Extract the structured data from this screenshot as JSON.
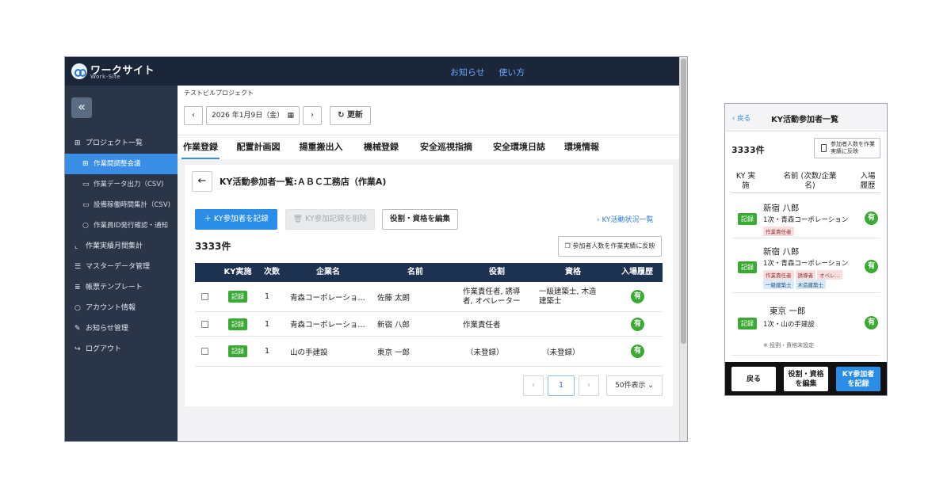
{
  "app": {
    "logo_name": "ワークサイト",
    "logo_sub": "Work-Site"
  },
  "topbar": {
    "links": [
      "お知らせ",
      "使い方"
    ]
  },
  "sidebar": {
    "items": [
      {
        "icon": "building-icon",
        "label": "プロジェクト一覧"
      },
      {
        "icon": "building-icon",
        "label": "作業間調整会議",
        "active": true
      },
      {
        "icon": "book-icon",
        "label": "作業データ出力（CSV)"
      },
      {
        "icon": "book-icon",
        "label": "設備稼働時間集計（CSV)"
      },
      {
        "icon": "person-icon",
        "label": "作業員ID発行確認・通知"
      },
      {
        "icon": "chart-icon",
        "label": "作業実績月間集計"
      },
      {
        "icon": "list-icon",
        "label": "マスターデータ管理"
      },
      {
        "icon": "list-icon",
        "label": "帳票テンプレート"
      },
      {
        "icon": "person-icon",
        "label": "アカウント情報"
      },
      {
        "icon": "pencil-icon",
        "label": "お知らせ管理"
      },
      {
        "icon": "logout-icon",
        "label": "ログアウト"
      }
    ]
  },
  "header": {
    "project": "テストビルプロジェクト",
    "date": "2026 年1月9日（金）",
    "refresh": "更新"
  },
  "tabs": [
    "作業登録",
    "配置計画図",
    "揚重搬出入",
    "機械登録",
    "安全巡視指摘",
    "安全環境日誌",
    "環境情報"
  ],
  "card": {
    "title": "KY活動参加者一覧:ＡＢＣ工務店（作業A)",
    "record_btn": "KY参加者を記録",
    "delete_btn": "KY参加記録を削除",
    "edit_btn": "役割・資格を編集",
    "status_link": "KY活動状況一覧",
    "count": "3333件",
    "reflect_btn": "参加者人数を作業実績に反映"
  },
  "table": {
    "headers": [
      "KY実施",
      "次数",
      "企業名",
      "名前",
      "役割",
      "資格",
      "入場履歴"
    ],
    "rows": [
      {
        "ky": "記録",
        "tier": "1",
        "company": "青森コーポレーショ…",
        "name": "佐藤 太朗",
        "role": "作業責任者, 誘導者, オペレーター",
        "qual": "一級建築士, 木造建築士",
        "history": "有"
      },
      {
        "ky": "記録",
        "tier": "1",
        "company": "青森コーポレーショ…",
        "name": "新宿 八郎",
        "role": "作業責任者",
        "qual": "",
        "history": "有"
      },
      {
        "ky": "記録",
        "tier": "1",
        "company": "山の手建設",
        "name": "東京 一郎",
        "role": "（未登録）",
        "qual": "（未登録）",
        "history": "有"
      }
    ]
  },
  "pager": {
    "current": "1",
    "per_page": "50件表示"
  },
  "mobile": {
    "back": "戻る",
    "title": "KY活動参加者一覧",
    "count": "3333件",
    "reflect": "参加者人数を作業実績に反映",
    "col_ky": "KY 実施",
    "col_name": "名前 (次数/企業名)",
    "col_hist": "入場 履歴",
    "items": [
      {
        "ky": "記録",
        "name": "新宿 八郎",
        "sub": "1次・青森コーポレーション",
        "tags": [
          "作業責任者"
        ],
        "tags2": [],
        "hist": "有"
      },
      {
        "ky": "記録",
        "name": "新宿 八郎",
        "sub": "1次・青森コーポレーション",
        "tags": [
          "作業責任者",
          "誘導者",
          "オペレ…"
        ],
        "tags2": [
          "一級建築士",
          "木造建築士"
        ],
        "hist": "有"
      },
      {
        "ky": "記録",
        "name": "東京 一郎",
        "sub": "1次・山の手建設",
        "tags": [],
        "tags2": [],
        "hist": "有",
        "note": "※ 役割・資格未設定"
      }
    ],
    "footer": {
      "back": "戻る",
      "edit": "役割・資格を編集",
      "record": "KY参加者を記録"
    }
  }
}
